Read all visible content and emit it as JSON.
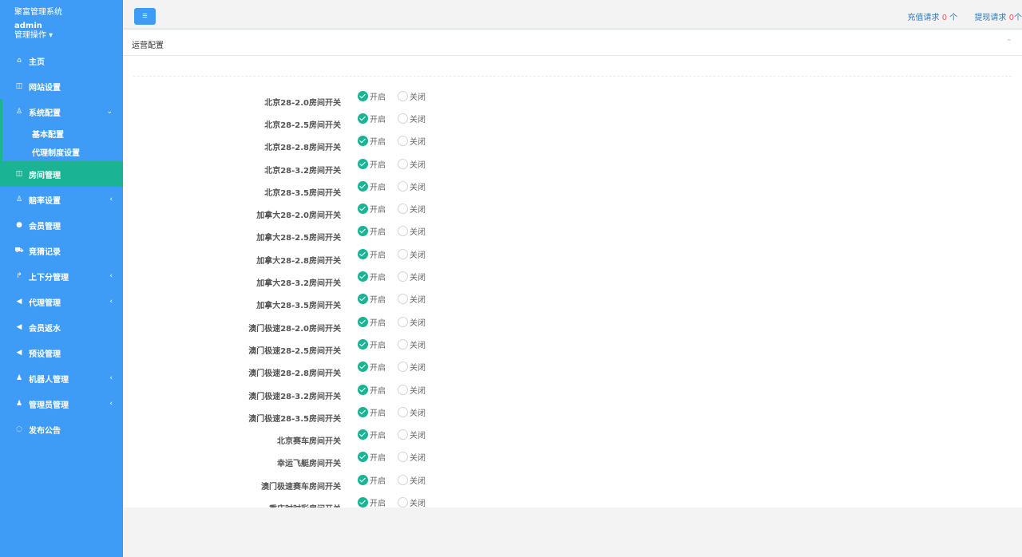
{
  "sidebar": {
    "app_title": "聚富管理系统",
    "admin_name": "admin",
    "admin_menu": "管理操作 ▾",
    "items": [
      {
        "label": "主页",
        "icon": "home-icon",
        "glyph": "⌂",
        "arrow": ""
      },
      {
        "label": "网站设置",
        "icon": "columns-icon",
        "glyph": "◫",
        "arrow": ""
      },
      {
        "label": "系统配置",
        "icon": "flask-icon",
        "glyph": "♙",
        "arrow": "⌄"
      },
      {
        "label": "房间管理",
        "icon": "columns-icon",
        "glyph": "◫",
        "arrow": ""
      },
      {
        "label": "赔率设置",
        "icon": "flask-icon",
        "glyph": "♙",
        "arrow": "‹"
      },
      {
        "label": "会员管理",
        "icon": "user-icon",
        "glyph": "●",
        "arrow": ""
      },
      {
        "label": "竞猜记录",
        "icon": "car-icon",
        "glyph": "⛟",
        "arrow": ""
      },
      {
        "label": "上下分管理",
        "icon": "level-up-icon",
        "glyph": "↱",
        "arrow": "‹"
      },
      {
        "label": "代理管理",
        "icon": "paper-plane-icon",
        "glyph": "◀",
        "arrow": "‹"
      },
      {
        "label": "会员返水",
        "icon": "paper-plane-icon",
        "glyph": "◀",
        "arrow": ""
      },
      {
        "label": "预设管理",
        "icon": "paper-plane-icon",
        "glyph": "◀",
        "arrow": ""
      },
      {
        "label": "机器人管理",
        "icon": "male-icon",
        "glyph": "♟",
        "arrow": "‹"
      },
      {
        "label": "管理员管理",
        "icon": "male-icon",
        "glyph": "♟",
        "arrow": "‹"
      },
      {
        "label": "发布公告",
        "icon": "comment-icon",
        "glyph": "◌",
        "arrow": ""
      }
    ],
    "subitems": [
      {
        "label": "基本配置"
      },
      {
        "label": "代理制度设置"
      }
    ]
  },
  "topbar": {
    "menu_glyph": "≡",
    "recharge_label": "充值请求",
    "recharge_count": "0",
    "recharge_unit": "个",
    "withdraw_label": "提现请求",
    "withdraw_count": "0",
    "withdraw_unit": "个"
  },
  "panel": {
    "title": "运营配置",
    "collapse_glyph": "⌃",
    "on_label": "开启",
    "off_label": "关闭",
    "rows": [
      {
        "label": "北京28-2.0房间开关",
        "on": true
      },
      {
        "label": "北京28-2.5房间开关",
        "on": true
      },
      {
        "label": "北京28-2.8房间开关",
        "on": true
      },
      {
        "label": "北京28-3.2房间开关",
        "on": true
      },
      {
        "label": "北京28-3.5房间开关",
        "on": true
      },
      {
        "label": "加拿大28-2.0房间开关",
        "on": true
      },
      {
        "label": "加拿大28-2.5房间开关",
        "on": true
      },
      {
        "label": "加拿大28-2.8房间开关",
        "on": true
      },
      {
        "label": "加拿大28-3.2房间开关",
        "on": true
      },
      {
        "label": "加拿大28-3.5房间开关",
        "on": true
      },
      {
        "label": "澳门极速28-2.0房间开关",
        "on": true
      },
      {
        "label": "澳门极速28-2.5房间开关",
        "on": true
      },
      {
        "label": "澳门极速28-2.8房间开关",
        "on": true
      },
      {
        "label": "澳门极速28-3.2房间开关",
        "on": true
      },
      {
        "label": "澳门极速28-3.5房间开关",
        "on": true
      },
      {
        "label": "北京赛车房间开关",
        "on": true
      },
      {
        "label": "幸运飞艇房间开关",
        "on": true
      },
      {
        "label": "澳门极速赛车房间开关",
        "on": true
      },
      {
        "label": "重庆时时彩房间开关",
        "on": true
      }
    ]
  }
}
